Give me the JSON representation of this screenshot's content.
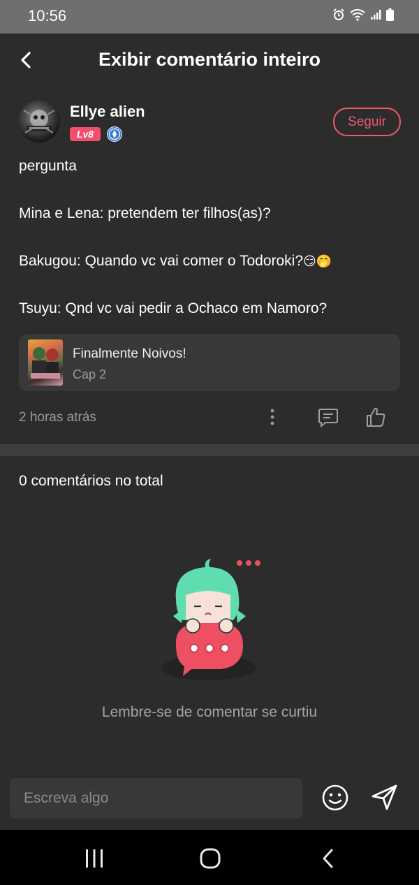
{
  "status_bar": {
    "time": "10:56"
  },
  "header": {
    "title": "Exibir comentário inteiro"
  },
  "author": {
    "name": "Ellye alien",
    "level": "Lv8",
    "follow_label": "Seguir"
  },
  "comment": {
    "lines": [
      "pergunta",
      "Mina e Lena: pretendem ter filhos(as)?",
      "Bakugou: Quando vc vai comer o Todoroki?",
      "Tsuyu: Qnd vc vai pedir a Ochaco em Namoro?"
    ],
    "emojis": "😏🤭"
  },
  "chapter": {
    "title": "Finalmente Noivos!",
    "subtitle": "Cap 2"
  },
  "meta": {
    "time_ago": "2 horas atrás"
  },
  "comments_section": {
    "total": "0 comentários no total",
    "empty_message": "Lembre-se de comentar se curtiu"
  },
  "input": {
    "placeholder": "Escreva algo"
  },
  "colors": {
    "accent": "#ef5a6f",
    "mascot_hair": "#5fdcb0",
    "background": "#2c2c2c"
  }
}
